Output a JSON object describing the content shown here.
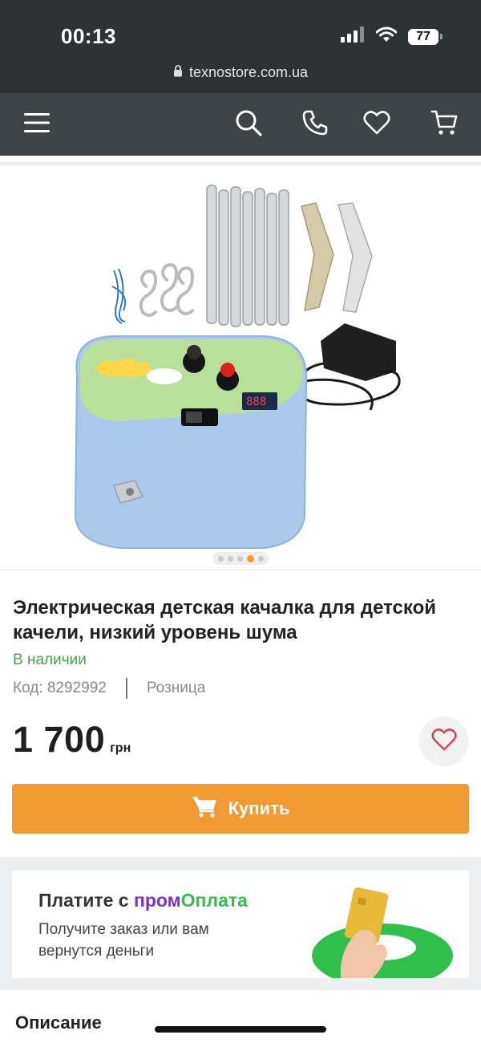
{
  "status_bar": {
    "time": "00:13",
    "battery": "77",
    "url": "texnostore.com.ua"
  },
  "nav": {
    "icons": [
      "menu-icon",
      "search-icon",
      "phone-icon",
      "heart-icon",
      "cart-icon"
    ]
  },
  "gallery": {
    "slide_count": 5,
    "active_slide": 4
  },
  "product": {
    "title": "Электрическая детская качалка для детской качели, низкий уровень шума",
    "stock": "В наличии",
    "code": "Код: 8292992",
    "price_type": "Розница",
    "price": "1 700",
    "currency": "грн",
    "buy_label": "Купить"
  },
  "promo": {
    "prefix": "Платите с ",
    "brand_a": "пром",
    "brand_b": "Оплата",
    "subtitle": "Получите заказ или вам вернутся деньги"
  },
  "description": {
    "title": "Описание"
  },
  "colors": {
    "accent": "#f19a33",
    "stock_green": "#4aa24a",
    "header": "#2e3235",
    "nav": "#3d4347",
    "favorite_red": "#d9434e"
  }
}
